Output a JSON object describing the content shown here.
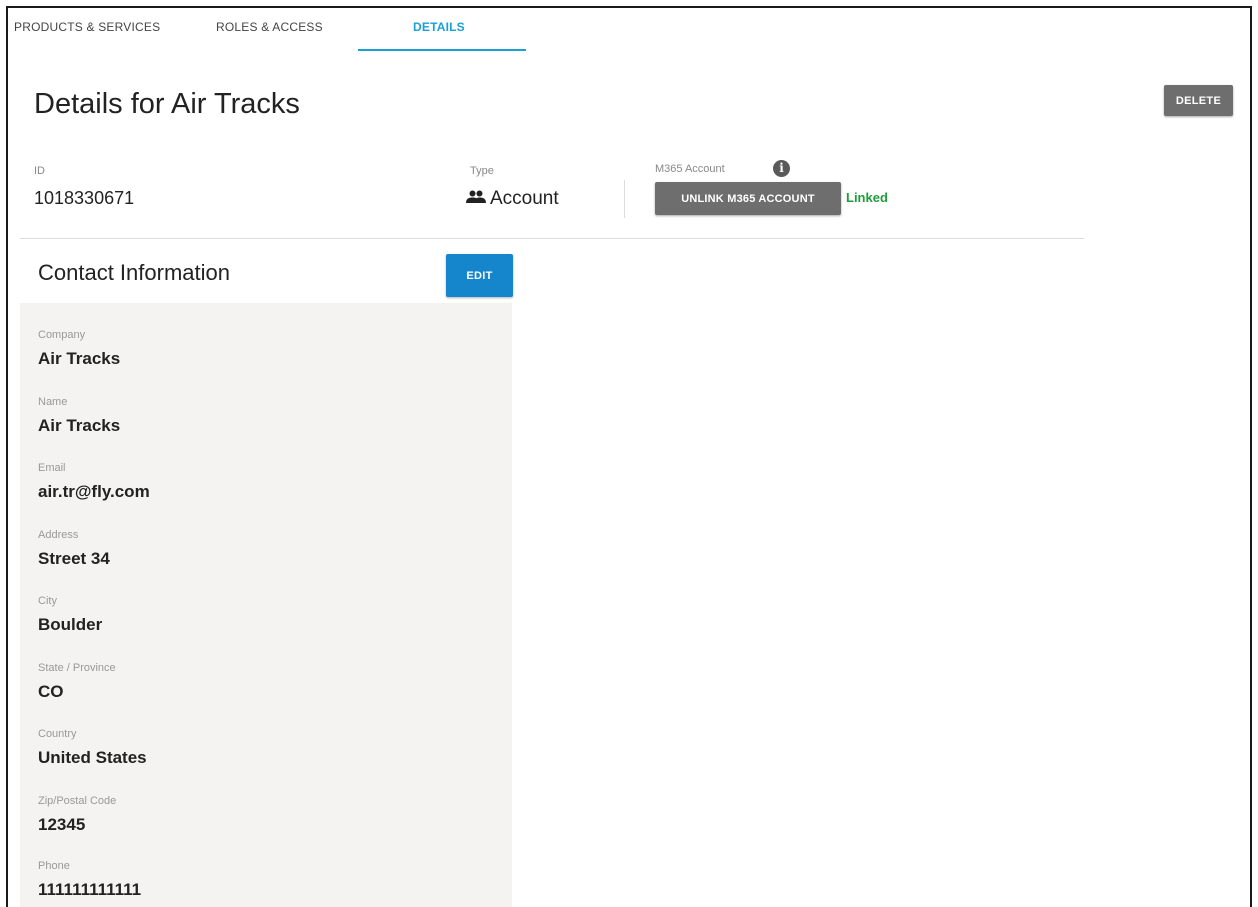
{
  "tabs": [
    {
      "label": "PRODUCTS & SERVICES",
      "active": false
    },
    {
      "label": "ROLES & ACCESS",
      "active": false
    },
    {
      "label": "DETAILS",
      "active": true
    }
  ],
  "header": {
    "title": "Details for Air Tracks",
    "delete_label": "DELETE"
  },
  "info": {
    "id_label": "ID",
    "id_value": "1018330671",
    "type_label": "Type",
    "type_icon": "people-icon",
    "type_value": "Account",
    "m365_label": "M365 Account",
    "m365_info_icon": "info-icon",
    "unlink_label": "UNLINK M365 ACCOUNT",
    "linked_status": "Linked"
  },
  "contact": {
    "title": "Contact Information",
    "edit_label": "EDIT",
    "fields": [
      {
        "label": "Company",
        "value": "Air Tracks"
      },
      {
        "label": "Name",
        "value": "Air Tracks"
      },
      {
        "label": "Email",
        "value": "air.tr@fly.com"
      },
      {
        "label": "Address",
        "value": "Street 34"
      },
      {
        "label": "City",
        "value": "Boulder"
      },
      {
        "label": "State / Province",
        "value": "CO"
      },
      {
        "label": "Country",
        "value": "United States"
      },
      {
        "label": "Zip/Postal Code",
        "value": "12345"
      },
      {
        "label": "Phone",
        "value": "111111111111"
      }
    ]
  },
  "colors": {
    "accent": "#1a9fd6",
    "edit_button": "#1585cc",
    "gray_button": "#6e6e6e",
    "linked": "#1e9e3a",
    "panel": "#f4f3f2"
  }
}
